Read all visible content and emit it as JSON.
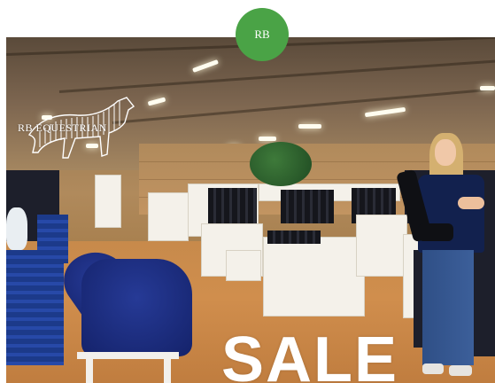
{
  "avatar": {
    "initials": "RB",
    "color": "#4aa346"
  },
  "hero": {
    "brand": "RB EQUESTRIAN",
    "brand_icon": "horse-icon",
    "sale_text": "SALE"
  }
}
